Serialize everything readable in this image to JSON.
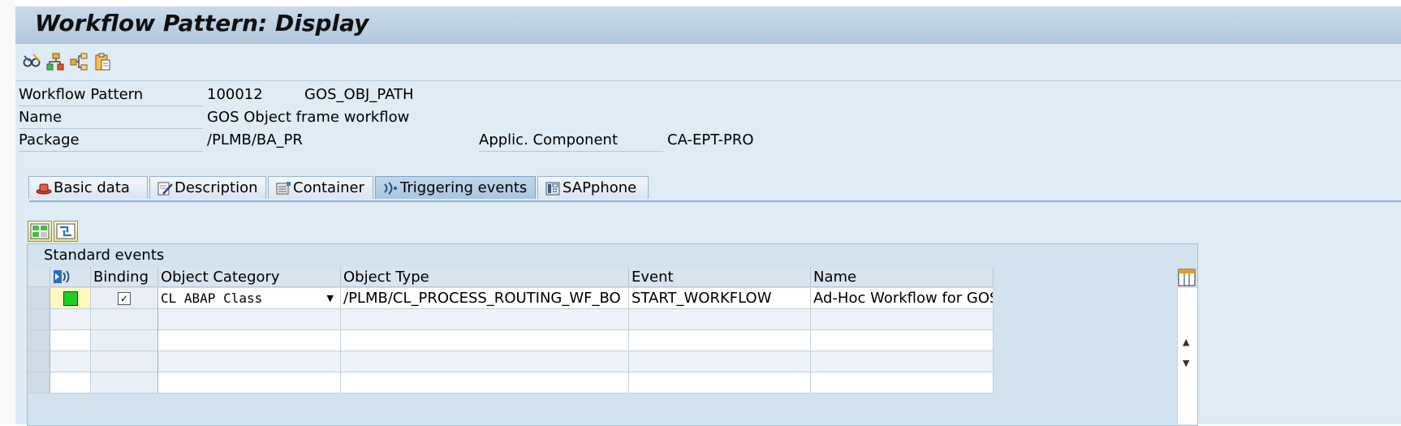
{
  "window": {
    "title": "Workflow Pattern: Display"
  },
  "toolbar": {
    "buttons": [
      {
        "icon": "glasses-icon"
      },
      {
        "icon": "hierarchy-icon"
      },
      {
        "icon": "structure-icon"
      },
      {
        "icon": "clipboard-icon"
      }
    ]
  },
  "header": {
    "workflow_pattern_label": "Workflow Pattern",
    "workflow_pattern_id": "100012",
    "workflow_pattern_code": "GOS_OBJ_PATH",
    "name_label": "Name",
    "name_value": "GOS Object frame workflow",
    "package_label": "Package",
    "package_value": "/PLMB/BA_PR",
    "applic_component_label": "Applic. Component",
    "applic_component_value": "CA-EPT-PRO"
  },
  "tabs": [
    {
      "label": "Basic data",
      "icon": "hat-icon"
    },
    {
      "label": "Description",
      "icon": "edit-icon"
    },
    {
      "label": "Container",
      "icon": "container-icon"
    },
    {
      "label": "Triggering events",
      "icon": "signal-icon",
      "active": true
    },
    {
      "label": "SAPphone",
      "icon": "phone-icon"
    }
  ],
  "events_table": {
    "title": "Standard events",
    "columns": [
      "Binding",
      "Object Category",
      "Object Type",
      "Event",
      "Name"
    ],
    "rows": [
      {
        "binding": true,
        "object_category": "CL ABAP Class",
        "object_type": "/PLMB/CL_PROCESS_ROUTING_WF_BO",
        "event": "START_WORKFLOW",
        "name": "Ad-Hoc Workflow for GOS …",
        "status_color": "#22cc22"
      }
    ]
  },
  "colors": {
    "app_background": "#dfebf5",
    "title_bar": "#b4c9dd",
    "active_tab": "#a9c6e1",
    "status_green": "#22cc22"
  }
}
